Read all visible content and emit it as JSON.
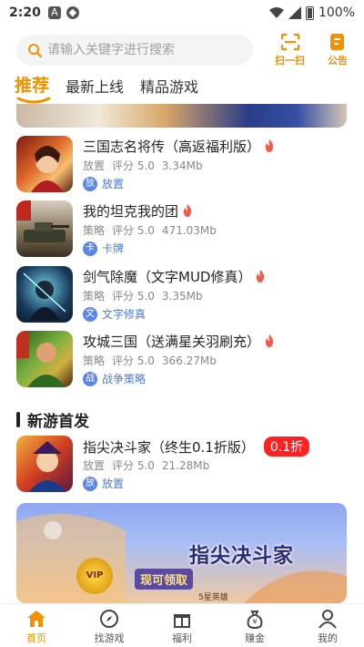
{
  "status": {
    "time": "2:20",
    "battery": "100%"
  },
  "search": {
    "placeholder": "请输入关键字进行搜索"
  },
  "header": {
    "scan_label": "扫一扫",
    "notice_label": "公告"
  },
  "tabs": [
    {
      "label": "推荐",
      "active": true
    },
    {
      "label": "最新上线",
      "active": false
    },
    {
      "label": "精品游戏",
      "active": false
    }
  ],
  "games": [
    {
      "title": "三国志名将传（高返福利版）",
      "genre": "放置",
      "score": "评分 5.0",
      "size": "3.34Mb",
      "tag_badge": "放",
      "tag": "放置",
      "hot": true
    },
    {
      "title": "我的坦克我的团",
      "genre": "策略",
      "score": "评分 5.0",
      "size": "471.03Mb",
      "tag_badge": "卡",
      "tag": "卡牌",
      "hot": true
    },
    {
      "title": "剑气除魔（文字MUD修真）",
      "genre": "策略",
      "score": "评分 5.0",
      "size": "3.35Mb",
      "tag_badge": "文",
      "tag": "文字修真",
      "hot": true
    },
    {
      "title": "攻城三国（送满星关羽刷充）",
      "genre": "策略",
      "score": "评分 5.0",
      "size": "366.27Mb",
      "tag_badge": "战",
      "tag": "战争策略",
      "hot": true
    }
  ],
  "new_section": {
    "title": "新游首发",
    "game": {
      "title": "指尖决斗家（终生0.1折版）",
      "discount": "0.1折",
      "genre": "放置",
      "score": "评分 5.0",
      "size": "21.28Mb",
      "tag_badge": "放",
      "tag": "放置"
    }
  },
  "promo": {
    "title": "指尖决斗家",
    "claim": "现可领取",
    "badge": "VIP",
    "sub": "5星英雄"
  },
  "nav": [
    {
      "label": "首页",
      "icon": "home-icon",
      "active": true
    },
    {
      "label": "找游戏",
      "icon": "compass-icon",
      "active": false
    },
    {
      "label": "福利",
      "icon": "gift-icon",
      "active": false
    },
    {
      "label": "赚金",
      "icon": "money-bag-icon",
      "active": false
    },
    {
      "label": "我的",
      "icon": "user-icon",
      "active": false
    }
  ],
  "colors": {
    "accent": "#f29100",
    "tag_blue": "#4a78e0",
    "hot_red": "#f25a4a",
    "discount_red": "#ff2222"
  }
}
